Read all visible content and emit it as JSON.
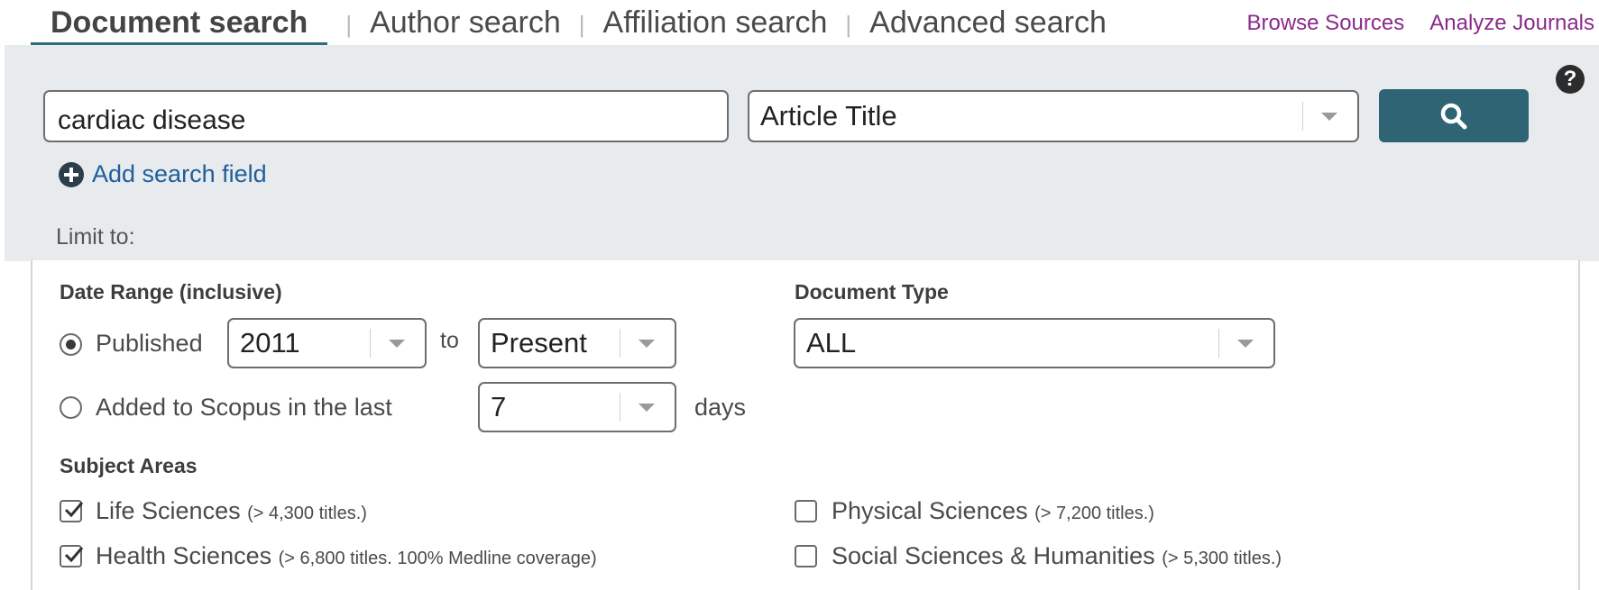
{
  "tabs": [
    {
      "label": "Document search",
      "active": true
    },
    {
      "label": "Author search",
      "active": false
    },
    {
      "label": "Affiliation search",
      "active": false
    },
    {
      "label": "Advanced search",
      "active": false
    }
  ],
  "tab_separator": "|",
  "top_links": {
    "browse": "Browse Sources",
    "analyze": "Analyze Journals"
  },
  "help": {
    "glyph": "?"
  },
  "search": {
    "query_value": "cardiac disease",
    "field_selected": "Article Title",
    "add_field_label": "Add search field",
    "button_icon": "search-icon"
  },
  "limit_to_label": "Limit to:",
  "date_range": {
    "heading": "Date Range (inclusive)",
    "published_label": "Published",
    "from_value": "2011",
    "to_label": "to",
    "to_value": "Present",
    "added_label": "Added to Scopus in the last",
    "days_value": "7",
    "days_label": "days",
    "selected": "published"
  },
  "document_type": {
    "heading": "Document Type",
    "selected": "ALL"
  },
  "subject_areas": {
    "heading": "Subject Areas",
    "items": [
      {
        "label": "Life Sciences",
        "note": "(> 4,300 titles.)",
        "checked": true
      },
      {
        "label": "Health Sciences",
        "note": "(> 6,800 titles. 100% Medline coverage)",
        "checked": true
      },
      {
        "label": "Physical Sciences",
        "note": "(> 7,200 titles.)",
        "checked": false
      },
      {
        "label": "Social Sciences & Humanities",
        "note": "(> 5,300 titles.)",
        "checked": false
      }
    ]
  },
  "colors": {
    "accent": "#2f6475",
    "link": "#1f5e9c",
    "top_link": "#8b2a8a",
    "panel_bg": "#e8ebed"
  }
}
